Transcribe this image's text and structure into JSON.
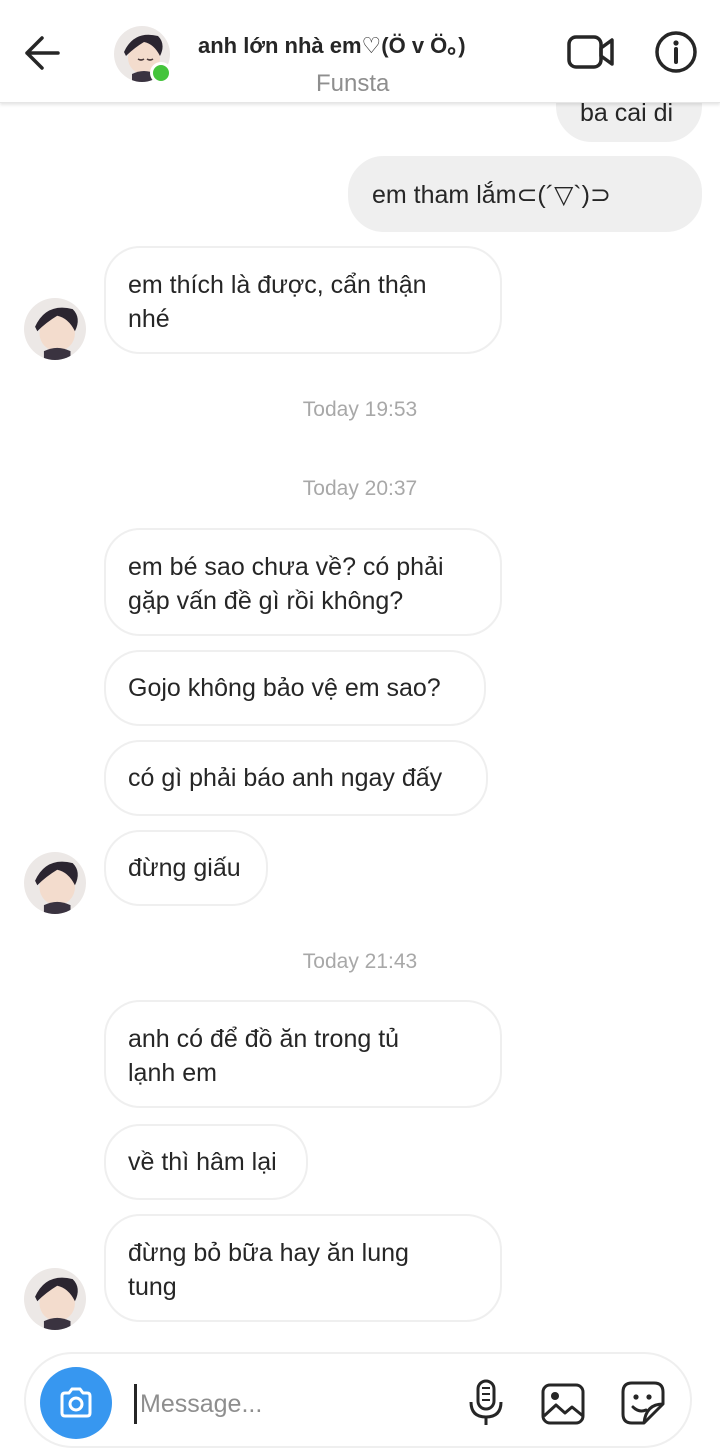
{
  "header": {
    "name": "anh lớn nhà em♡(Ö v Ö。)",
    "subtitle": "Funsta"
  },
  "messages": {
    "m0": [
      "ba cai di"
    ],
    "m1": [
      "em tham lắm⊂(´▽`)⊃"
    ],
    "m2": [
      "em thích là được, cẩn thận",
      "nhé"
    ],
    "ts1": "Today 19:53",
    "ts2": "Today 20:37",
    "m3": [
      "em bé sao chưa về? có phải",
      "gặp vấn đề gì rồi không?"
    ],
    "m4": [
      "Gojo không bảo vệ em sao?"
    ],
    "m5": [
      "có gì phải báo anh ngay đấy"
    ],
    "m6": [
      "đừng giấu"
    ],
    "ts3": "Today 21:43",
    "m7": [
      "anh có để đồ ăn trong tủ",
      "lạnh em"
    ],
    "m8": [
      "về thì hâm lại"
    ],
    "m9": [
      "đừng bỏ bữa hay ăn lung",
      "tung"
    ]
  },
  "composer": {
    "placeholder": "Message..."
  },
  "icons": {
    "back": "arrow-left-icon",
    "video": "video-camera-icon",
    "info": "info-icon",
    "camera": "camera-icon",
    "mic": "microphone-icon",
    "gallery": "image-icon",
    "sticker": "sticker-icon"
  },
  "colors": {
    "accent": "#3797f0",
    "online": "#44c43c",
    "bubble_out": "#efefef",
    "bubble_in_border": "#efefef",
    "timestamp": "#a8a8a8"
  }
}
